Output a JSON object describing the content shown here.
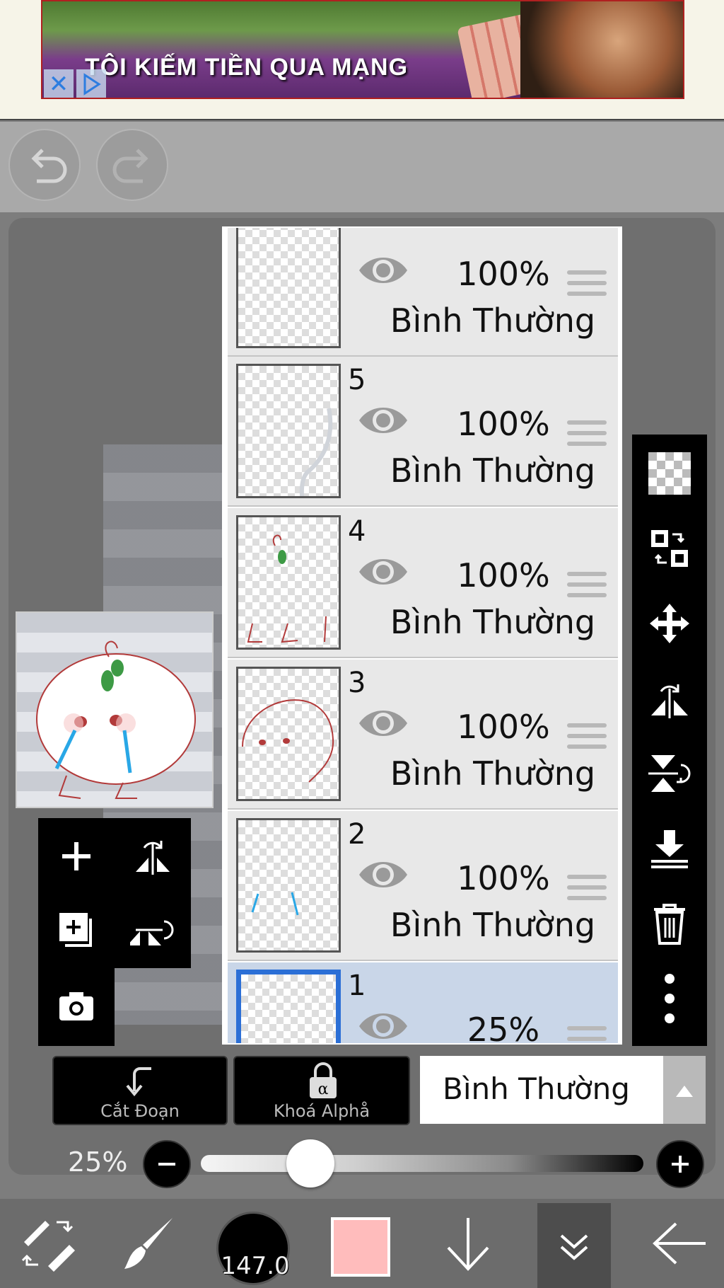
{
  "ad": {
    "text": "TÔI KIẾM TIỀN QUA MẠNG",
    "close_glyph": "✕"
  },
  "layers": [
    {
      "number": "",
      "opacity": "100%",
      "blend": "Bình Thường",
      "selected": false
    },
    {
      "number": "5",
      "opacity": "100%",
      "blend": "Bình Thường",
      "selected": false
    },
    {
      "number": "4",
      "opacity": "100%",
      "blend": "Bình Thường",
      "selected": false
    },
    {
      "number": "3",
      "opacity": "100%",
      "blend": "Bình Thường",
      "selected": false
    },
    {
      "number": "2",
      "opacity": "100%",
      "blend": "Bình Thường",
      "selected": false
    },
    {
      "number": "1",
      "opacity": "25%",
      "blend": "",
      "selected": true
    }
  ],
  "actions": {
    "clip_label": "Cắt Đoạn",
    "alpha_lock_label": "Khoá Alphå",
    "blend_mode": "Bình Thường"
  },
  "opacity": {
    "label": "25%",
    "value": 0.25
  },
  "bottom_nav": {
    "brush_size": "147.0",
    "color": "#ffbcbc"
  },
  "colors": {
    "selected_border": "#2b6fd6",
    "selected_bg": "#c9d6e8"
  }
}
